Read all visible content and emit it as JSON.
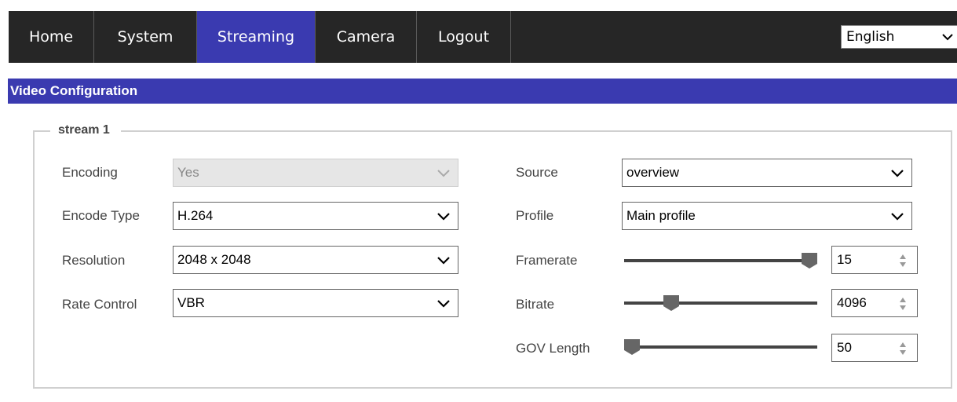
{
  "nav": {
    "items": [
      {
        "label": "Home",
        "active": false
      },
      {
        "label": "System",
        "active": false
      },
      {
        "label": "Streaming",
        "active": true
      },
      {
        "label": "Camera",
        "active": false
      },
      {
        "label": "Logout",
        "active": false
      }
    ],
    "language": {
      "value": "English",
      "icon": "chevron-down-icon"
    }
  },
  "colors": {
    "nav_bg": "#262626",
    "accent": "#3a3ab0",
    "fieldset_border": "#d0d0d0",
    "disabled_bg": "#e6e6e6"
  },
  "section": {
    "title": "Video Configuration"
  },
  "stream": {
    "legend": "stream 1",
    "encoding": {
      "label": "Encoding",
      "value": "Yes",
      "disabled": true
    },
    "encode_type": {
      "label": "Encode Type",
      "value": "H.264"
    },
    "resolution": {
      "label": "Resolution",
      "value": "2048 x 2048"
    },
    "rate_control": {
      "label": "Rate Control",
      "value": "VBR"
    },
    "source": {
      "label": "Source",
      "value": "overview"
    },
    "profile": {
      "label": "Profile",
      "value": "Main profile"
    },
    "framerate": {
      "label": "Framerate",
      "value": "15",
      "slider_fraction": 1.0
    },
    "bitrate": {
      "label": "Bitrate",
      "value": "4096",
      "slider_fraction": 0.22
    },
    "gov_length": {
      "label": "GOV Length",
      "value": "50",
      "slider_fraction": 0.0
    }
  }
}
